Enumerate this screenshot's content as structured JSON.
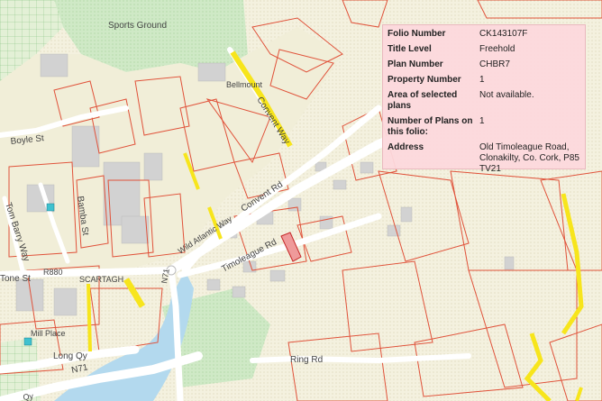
{
  "info_panel": {
    "rows": [
      {
        "label": "Folio Number",
        "value": "CK143107F"
      },
      {
        "label": "Title Level",
        "value": "Freehold"
      },
      {
        "label": "Plan Number",
        "value": "CHBR7"
      },
      {
        "label": "Property Number",
        "value": "1"
      },
      {
        "label": "Area of selected plans",
        "value": "Not available."
      },
      {
        "label": "Number of Plans on this folio:",
        "value": "1"
      },
      {
        "label": "Address",
        "value": "Old Timoleague Road, Clonakilty, Co. Cork, P85 TV21"
      }
    ]
  },
  "map_labels": {
    "sports_ground": "Sports Ground",
    "belmount": "Bellmount",
    "convent_way": "Convent Way",
    "boyle_st": "Boyle St",
    "bamba_st": "Bamba St",
    "tom_barry_way": "Tom Barry Way",
    "convent_rd": "Convent Rd",
    "wild_atlantic_way": "Wild Atlantic Way",
    "timoleague_rd": "Timoleague Rd",
    "r880": "R880",
    "tone_st": "Tone St",
    "scartagh": "SCARTAGH",
    "n71_a": "N71",
    "n71_b": "N71",
    "mill_place": "Mill Place",
    "long_qy": "Long Qy",
    "ring_rd": "Ring Rd",
    "qy": "Qy"
  },
  "colors": {
    "land": "#f4f1df",
    "green": "#cfe9c6",
    "water": "#b3d9ee",
    "road": "#ffffff",
    "building": "#d2d2d2",
    "boundary": "#e0523a",
    "highlight": "#f7e51c",
    "selected_plot": "#ef9a9a",
    "panel": "#fcd8dc"
  }
}
